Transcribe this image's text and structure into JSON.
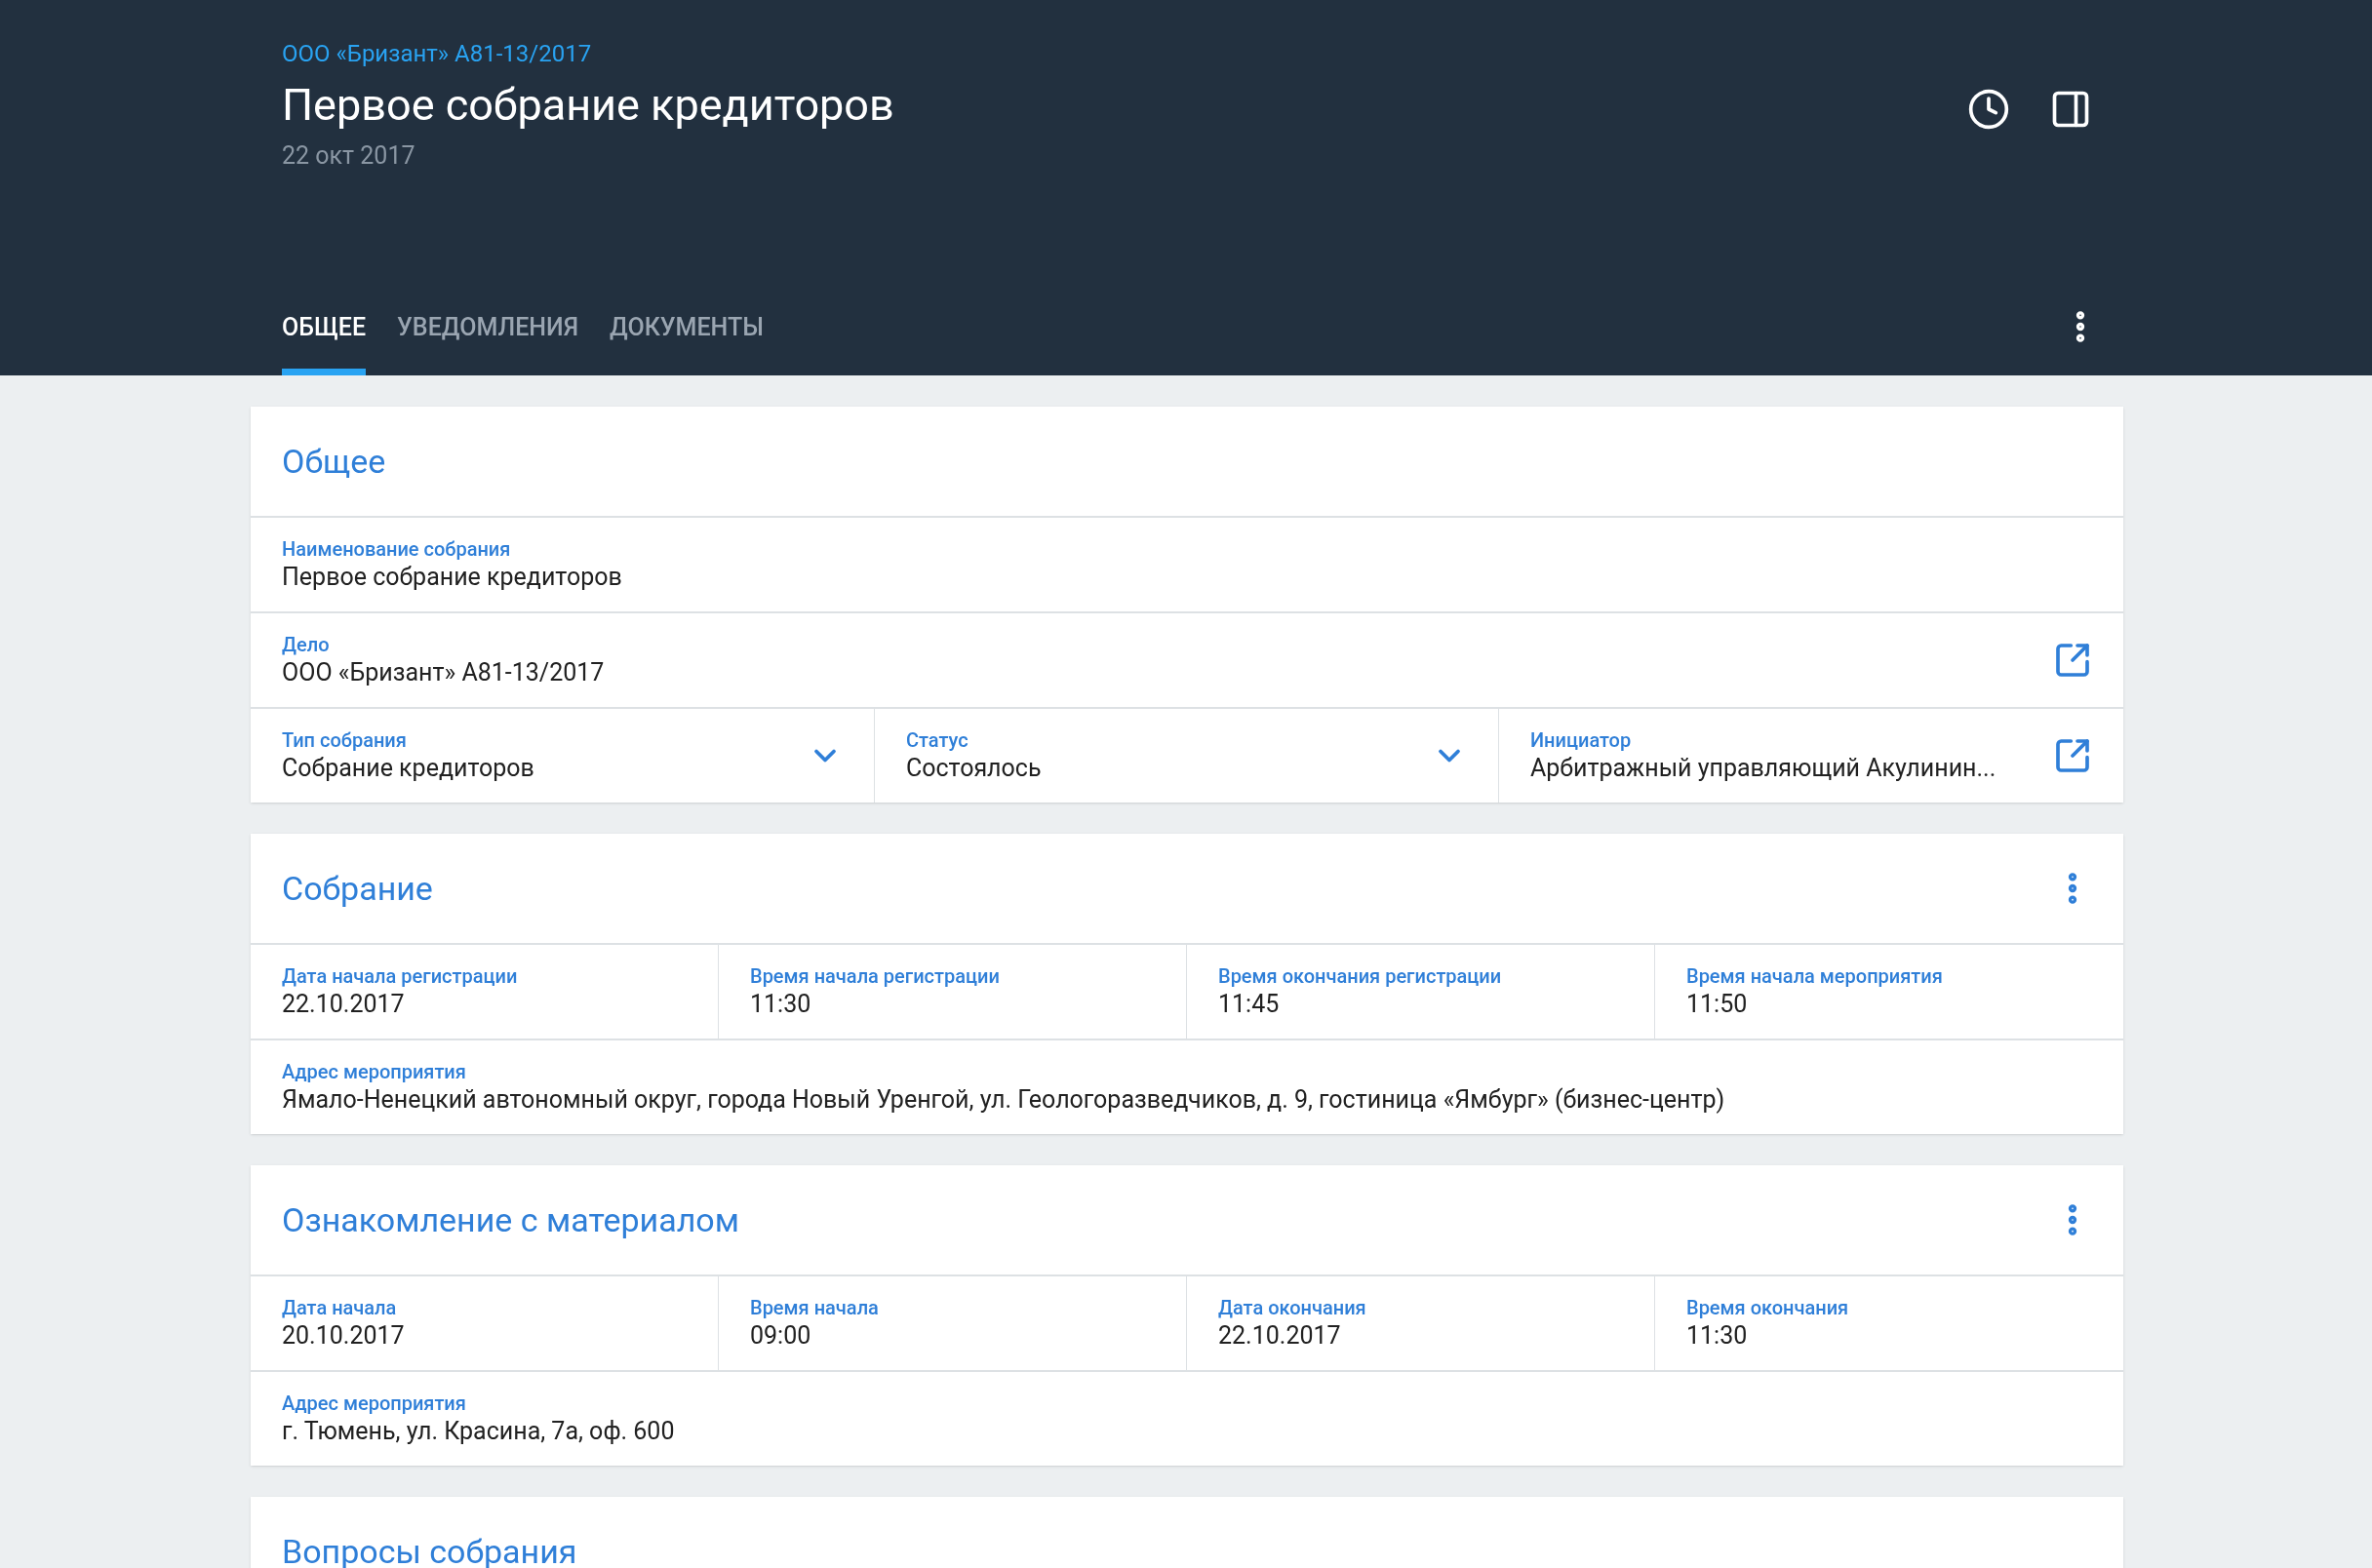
{
  "header": {
    "breadcrumb": "ООО «Бризант» А81-13/2017",
    "title": "Первое собрание кредиторов",
    "date": "22 окт 2017",
    "tabs": [
      {
        "label": "ОБЩЕЕ",
        "selected": true
      },
      {
        "label": "УВЕДОМЛЕНИЯ",
        "selected": false
      },
      {
        "label": "ДОКУМЕНТЫ",
        "selected": false
      }
    ]
  },
  "cards": [
    {
      "title": "Общее",
      "menu": false,
      "rows": [
        [
          {
            "label": "Наименование собрания",
            "value": "Первое собрание кредиторов",
            "kind": "plain"
          }
        ],
        [
          {
            "label": "Дело",
            "value": "ООО «Бризант» А81-13/2017",
            "kind": "link"
          }
        ],
        [
          {
            "label": "Тип собрания",
            "value": "Собрание кредиторов",
            "kind": "dropdown"
          },
          {
            "label": "Статус",
            "value": "Состоялось",
            "kind": "dropdown"
          },
          {
            "label": "Инициатор",
            "value": "Арбитражный управляющий Акулинин...",
            "kind": "link"
          }
        ]
      ]
    },
    {
      "title": "Собрание",
      "menu": true,
      "rows": [
        [
          {
            "label": "Дата начала регистрации",
            "value": "22.10.2017",
            "kind": "plain"
          },
          {
            "label": "Время начала регистрации",
            "value": "11:30",
            "kind": "plain"
          },
          {
            "label": "Время окончания регистрации",
            "value": "11:45",
            "kind": "plain"
          },
          {
            "label": "Время начала мероприятия",
            "value": "11:50",
            "kind": "plain"
          }
        ],
        [
          {
            "label": "Адрес мероприятия",
            "value": "Ямало-Ненецкий автономный округ, города Новый Уренгой, ул. Геологоразведчиков, д. 9, гостиница «Ямбург» (бизнес-центр)",
            "kind": "plain"
          }
        ]
      ]
    },
    {
      "title": "Ознакомление с материалом",
      "menu": true,
      "rows": [
        [
          {
            "label": "Дата начала",
            "value": "20.10.2017",
            "kind": "plain"
          },
          {
            "label": "Время начала",
            "value": "09:00",
            "kind": "plain"
          },
          {
            "label": "Дата окончания",
            "value": "22.10.2017",
            "kind": "plain"
          },
          {
            "label": "Время окончания",
            "value": "11:30",
            "kind": "plain"
          }
        ],
        [
          {
            "label": "Адрес мероприятия",
            "value": "г. Тюмень, ул. Красина, 7а, оф. 600",
            "kind": "plain"
          }
        ]
      ]
    },
    {
      "title": "Вопросы собрания",
      "menu": false
    }
  ]
}
